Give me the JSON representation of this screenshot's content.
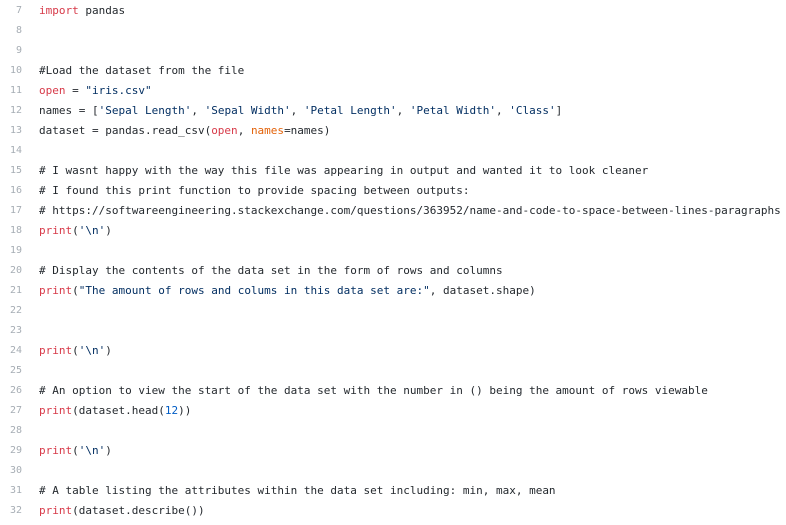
{
  "editor": {
    "lines": [
      {
        "number": "7",
        "segments": [
          {
            "t": "import",
            "c": "kw"
          },
          {
            "t": " pandas",
            "c": ""
          }
        ]
      },
      {
        "number": "8",
        "segments": []
      },
      {
        "number": "9",
        "segments": []
      },
      {
        "number": "10",
        "segments": [
          {
            "t": "#Load the dataset from the file",
            "c": "comment"
          }
        ]
      },
      {
        "number": "11",
        "segments": [
          {
            "t": "open",
            "c": "kw"
          },
          {
            "t": " = ",
            "c": ""
          },
          {
            "t": "\"iris.csv\"",
            "c": "str"
          }
        ]
      },
      {
        "number": "12",
        "segments": [
          {
            "t": "names = [",
            "c": ""
          },
          {
            "t": "'Sepal Length'",
            "c": "str"
          },
          {
            "t": ", ",
            "c": ""
          },
          {
            "t": "'Sepal Width'",
            "c": "str"
          },
          {
            "t": ", ",
            "c": ""
          },
          {
            "t": "'Petal Length'",
            "c": "str"
          },
          {
            "t": ", ",
            "c": ""
          },
          {
            "t": "'Petal Width'",
            "c": "str"
          },
          {
            "t": ", ",
            "c": ""
          },
          {
            "t": "'Class'",
            "c": "str"
          },
          {
            "t": "]",
            "c": ""
          }
        ]
      },
      {
        "number": "13",
        "segments": [
          {
            "t": "dataset = pandas.read_csv(",
            "c": ""
          },
          {
            "t": "open",
            "c": "kw"
          },
          {
            "t": ", ",
            "c": ""
          },
          {
            "t": "names",
            "c": "param"
          },
          {
            "t": "=names)",
            "c": ""
          }
        ]
      },
      {
        "number": "14",
        "segments": []
      },
      {
        "number": "15",
        "segments": [
          {
            "t": "# I wasnt happy with the way this file was appearing in output and wanted it to look cleaner",
            "c": "comment"
          }
        ]
      },
      {
        "number": "16",
        "segments": [
          {
            "t": "# I found this print function to provide spacing between outputs:",
            "c": "comment"
          }
        ]
      },
      {
        "number": "17",
        "segments": [
          {
            "t": "# https://softwareengineering.stackexchange.com/questions/363952/name-and-code-to-space-between-lines-paragraphs",
            "c": "comment"
          }
        ]
      },
      {
        "number": "18",
        "segments": [
          {
            "t": "print",
            "c": "kw"
          },
          {
            "t": "(",
            "c": ""
          },
          {
            "t": "'\\n'",
            "c": "str"
          },
          {
            "t": ")",
            "c": ""
          }
        ]
      },
      {
        "number": "19",
        "segments": []
      },
      {
        "number": "20",
        "segments": [
          {
            "t": "# Display the contents of the data set in the form of rows and columns",
            "c": "comment"
          }
        ]
      },
      {
        "number": "21",
        "segments": [
          {
            "t": "print",
            "c": "kw"
          },
          {
            "t": "(",
            "c": ""
          },
          {
            "t": "\"The amount of rows and colums in this data set are:\"",
            "c": "str"
          },
          {
            "t": ", dataset.shape)",
            "c": ""
          }
        ]
      },
      {
        "number": "22",
        "segments": []
      },
      {
        "number": "23",
        "segments": []
      },
      {
        "number": "24",
        "segments": [
          {
            "t": "print",
            "c": "kw"
          },
          {
            "t": "(",
            "c": ""
          },
          {
            "t": "'\\n'",
            "c": "str"
          },
          {
            "t": ")",
            "c": ""
          }
        ]
      },
      {
        "number": "25",
        "segments": []
      },
      {
        "number": "26",
        "segments": [
          {
            "t": "# An option to view the start of the data set with the number in () being the amount of rows viewable",
            "c": "comment"
          }
        ]
      },
      {
        "number": "27",
        "segments": [
          {
            "t": "print",
            "c": "kw"
          },
          {
            "t": "(dataset.head(",
            "c": ""
          },
          {
            "t": "12",
            "c": "num"
          },
          {
            "t": "))",
            "c": ""
          }
        ]
      },
      {
        "number": "28",
        "segments": []
      },
      {
        "number": "29",
        "segments": [
          {
            "t": "print",
            "c": "kw"
          },
          {
            "t": "(",
            "c": ""
          },
          {
            "t": "'\\n'",
            "c": "str"
          },
          {
            "t": ")",
            "c": ""
          }
        ]
      },
      {
        "number": "30",
        "segments": []
      },
      {
        "number": "31",
        "segments": [
          {
            "t": "# A table listing the attributes within the data set including: min, max, mean",
            "c": "comment"
          }
        ]
      },
      {
        "number": "32",
        "segments": [
          {
            "t": "print",
            "c": "kw"
          },
          {
            "t": "(dataset.describe())",
            "c": ""
          }
        ]
      }
    ]
  },
  "colors": {
    "keyword": "#d73a49",
    "string": "#032f62",
    "number": "#005cc5",
    "parameter": "#e36209",
    "text": "#24292e",
    "line_number": "#a6adb4",
    "background": "#ffffff"
  }
}
